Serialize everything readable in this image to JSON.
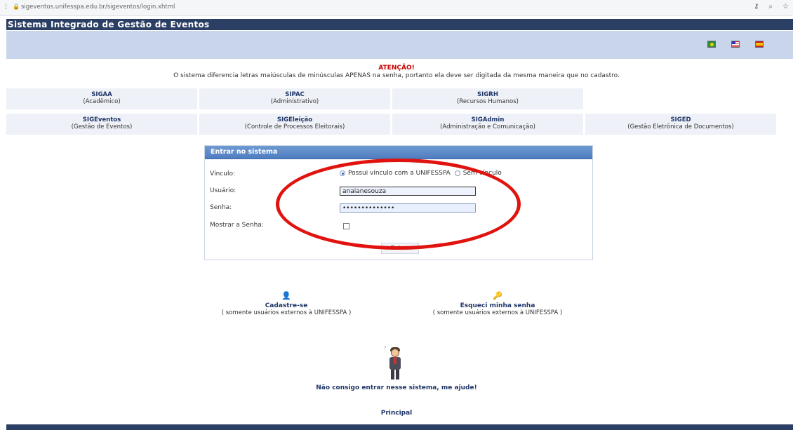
{
  "browser": {
    "url": "sigeventos.unifesspa.edu.br/sigeventos/login.xhtml"
  },
  "header": {
    "title": "Sistema Integrado de Gestão de Eventos"
  },
  "languages": [
    "flag-brazil-icon",
    "flag-usa-icon",
    "flag-spain-icon"
  ],
  "attention": {
    "title": "ATENÇÃO!",
    "message": "O sistema diferencia letras maiúsculas de minúsculas APENAS na senha, portanto ela deve ser digitada da mesma maneira que no cadastro."
  },
  "systems": {
    "row1": [
      {
        "name": "SIGAA",
        "desc": "(Acadêmico)"
      },
      {
        "name": "SIPAC",
        "desc": "(Administrativo)"
      },
      {
        "name": "SIGRH",
        "desc": "(Recursos Humanos)"
      }
    ],
    "row2": [
      {
        "name": "SIGEventos",
        "desc": "(Gestão de Eventos)"
      },
      {
        "name": "SIGEleição",
        "desc": "(Controle de Processos Eleitorais)"
      },
      {
        "name": "SIGAdmin",
        "desc": "(Administração e Comunicação)"
      },
      {
        "name": "SIGED",
        "desc": "(Gestão Eletrônica de Documentos)"
      }
    ]
  },
  "login": {
    "title": "Entrar no sistema",
    "vinculo_label": "Vínculo:",
    "vinculo_option1": "Possui vínculo com a UNIFESSPA",
    "vinculo_option2": "Sem vínculo",
    "vinculo_selected": "Possui vínculo com a UNIFESSPA",
    "usuario_label": "Usuário:",
    "usuario_value": "anaianesouza",
    "senha_label": "Senha:",
    "senha_value": "••••••••••••••",
    "mostrar_label": "Mostrar a Senha:",
    "mostrar_checked": false,
    "enter_label": "Entrar"
  },
  "links": {
    "cadastre_title": "Cadastre-se",
    "cadastre_sub": "( somente usuários externos à UNIFESSPA )",
    "esqueci_title": "Esqueci minha senha",
    "esqueci_sub": "( somente usuários externos à UNIFESSPA )"
  },
  "help_text": "Não consigo entrar nesse sistema, me ajude!",
  "principal": "Principal",
  "colors": {
    "header_dark": "#2b3e63",
    "header_light": "#c9d5ea",
    "attention_red": "#cc0000",
    "link_blue": "#1f3668",
    "annotation_red": "#e1130f"
  }
}
